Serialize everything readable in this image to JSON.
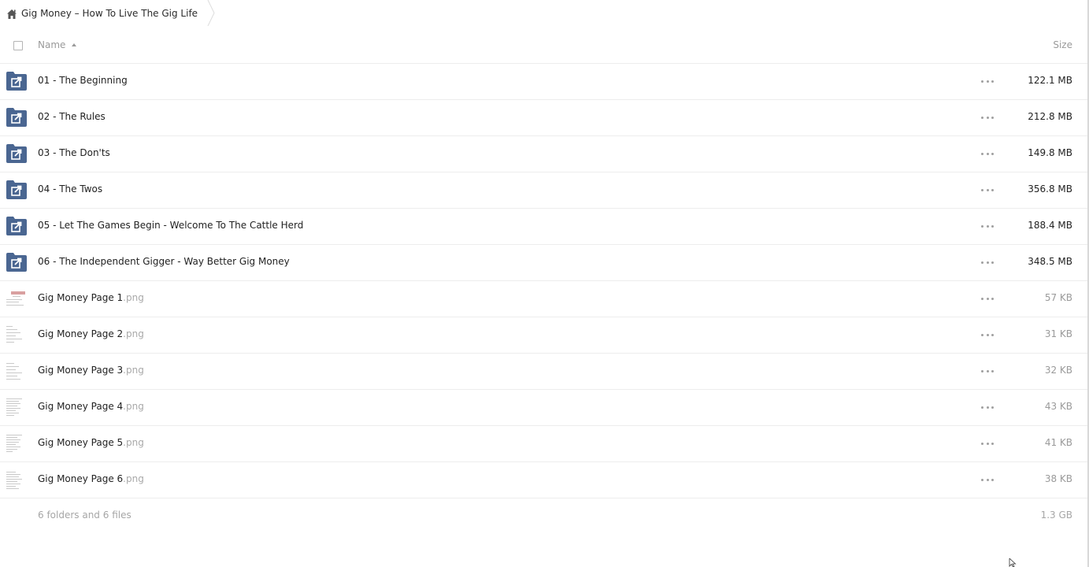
{
  "breadcrumb": {
    "home_icon": "home-icon",
    "title": "Gig Money – How To Live The Gig Life"
  },
  "header": {
    "name_label": "Name",
    "size_label": "Size",
    "sort_icon": "sort-ascending-icon"
  },
  "colors": {
    "folder": "#4a6691",
    "border": "#ededed",
    "muted_text": "#9a9a9a"
  },
  "rows": [
    {
      "type": "folder",
      "icon": "shared-folder-icon",
      "name": "01 - The Beginning",
      "ext": "",
      "size": "122.1 MB"
    },
    {
      "type": "folder",
      "icon": "shared-folder-icon",
      "name": "02 - The Rules",
      "ext": "",
      "size": "212.8 MB"
    },
    {
      "type": "folder",
      "icon": "shared-folder-icon",
      "name": "03 - The Don'ts",
      "ext": "",
      "size": "149.8 MB"
    },
    {
      "type": "folder",
      "icon": "shared-folder-icon",
      "name": "04 - The Twos",
      "ext": "",
      "size": "356.8 MB"
    },
    {
      "type": "folder",
      "icon": "shared-folder-icon",
      "name": "05 - Let The Games Begin - Welcome To The Cattle Herd",
      "ext": "",
      "size": "188.4 MB"
    },
    {
      "type": "folder",
      "icon": "shared-folder-icon",
      "name": "06 - The Independent Gigger - Way Better Gig Money",
      "ext": "",
      "size": "348.5 MB"
    },
    {
      "type": "file",
      "icon": "image-thumbnail",
      "name": "Gig Money Page 1",
      "ext": ".png",
      "size": "57 KB"
    },
    {
      "type": "file",
      "icon": "image-thumbnail",
      "name": "Gig Money Page 2",
      "ext": ".png",
      "size": "31 KB"
    },
    {
      "type": "file",
      "icon": "image-thumbnail",
      "name": "Gig Money Page 3",
      "ext": ".png",
      "size": "32 KB"
    },
    {
      "type": "file",
      "icon": "image-thumbnail",
      "name": "Gig Money Page 4",
      "ext": ".png",
      "size": "43 KB"
    },
    {
      "type": "file",
      "icon": "image-thumbnail",
      "name": "Gig Money Page 5",
      "ext": ".png",
      "size": "41 KB"
    },
    {
      "type": "file",
      "icon": "image-thumbnail",
      "name": "Gig Money Page 6",
      "ext": ".png",
      "size": "38 KB"
    }
  ],
  "summary": {
    "text": "6 folders and 6 files",
    "total_size": "1.3 GB"
  }
}
